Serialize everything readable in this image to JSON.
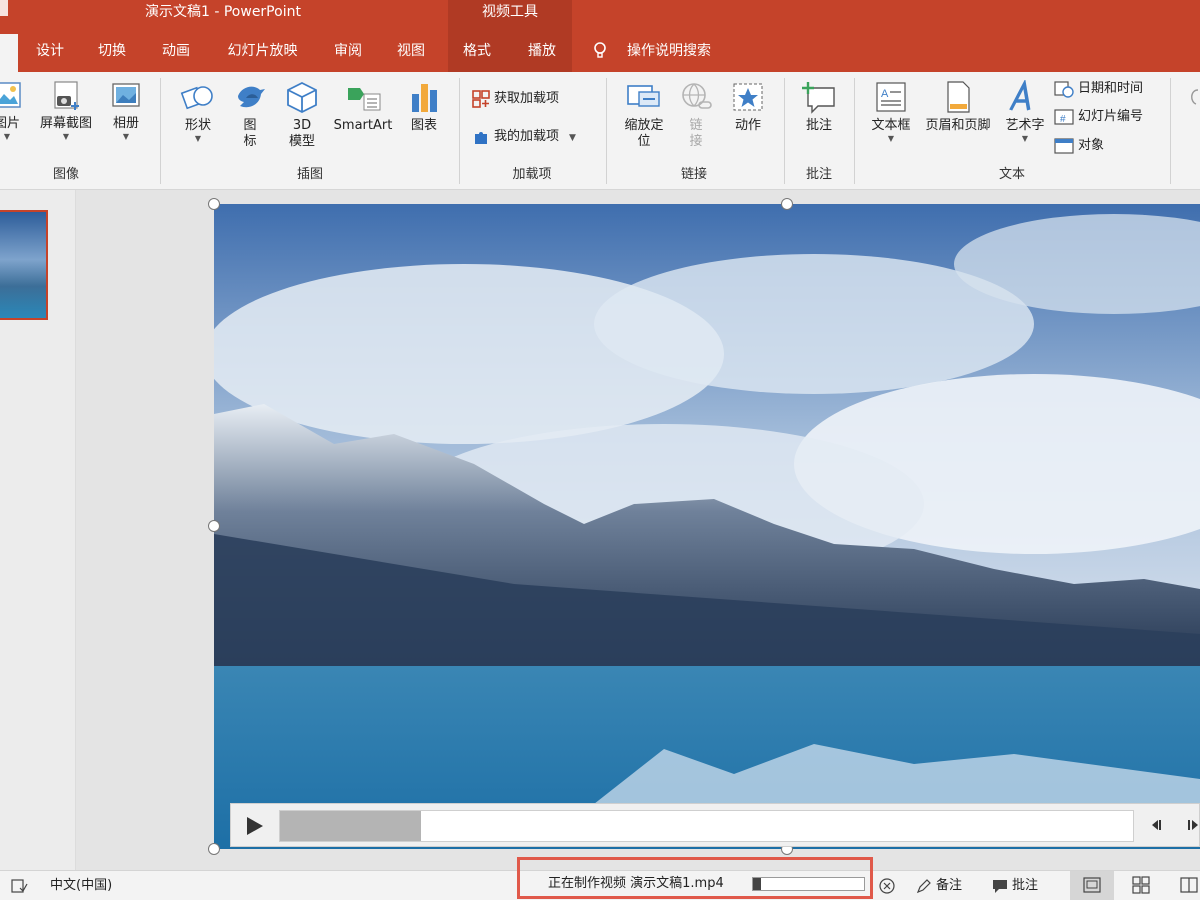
{
  "title_bar": {
    "document_title": "演示文稿1  -  PowerPoint",
    "context_tab_group": "视频工具"
  },
  "tabs": [
    {
      "label": "设计"
    },
    {
      "label": "切换"
    },
    {
      "label": "动画"
    },
    {
      "label": "幻灯片放映"
    },
    {
      "label": "审阅"
    },
    {
      "label": "视图"
    },
    {
      "label": "格式"
    },
    {
      "label": "播放"
    },
    {
      "label": "操作说明搜索"
    }
  ],
  "ribbon": {
    "images_group": {
      "label": "图像",
      "pictures": "图片",
      "screenshot": "屏幕截图",
      "album": "相册"
    },
    "illustrations_group": {
      "label": "插图",
      "shapes": "形状",
      "icons_line1": "图",
      "icons_line2": "标",
      "model3d_line1": "3D",
      "model3d_line2": "模型",
      "smartart": "SmartArt",
      "chart": "图表"
    },
    "addins_group": {
      "label": "加载项",
      "get_addins": "获取加载项",
      "my_addins": "我的加载项"
    },
    "links_group": {
      "label": "链接",
      "zoom_line1": "缩放定",
      "zoom_line2": "位",
      "link_line1": "链",
      "link_line2": "接",
      "action": "动作"
    },
    "comments_group": {
      "label": "批注",
      "comment": "批注"
    },
    "text_group": {
      "label": "文本",
      "textbox": "文本框",
      "header_footer": "页眉和页脚",
      "wordart": "艺术字",
      "date_time": "日期和时间",
      "slide_number": "幻灯片编号",
      "object": "对象"
    }
  },
  "video_player": {
    "played_fraction": 0.165
  },
  "status_bar": {
    "language": "中文(中国)",
    "export_status": "正在制作视频 演示文稿1.mp4",
    "export_progress_fraction": 0.07,
    "notes": "备注",
    "comments": "批注"
  },
  "colors": {
    "accent": "#c5432a",
    "highlight_box": "#e0594a"
  }
}
